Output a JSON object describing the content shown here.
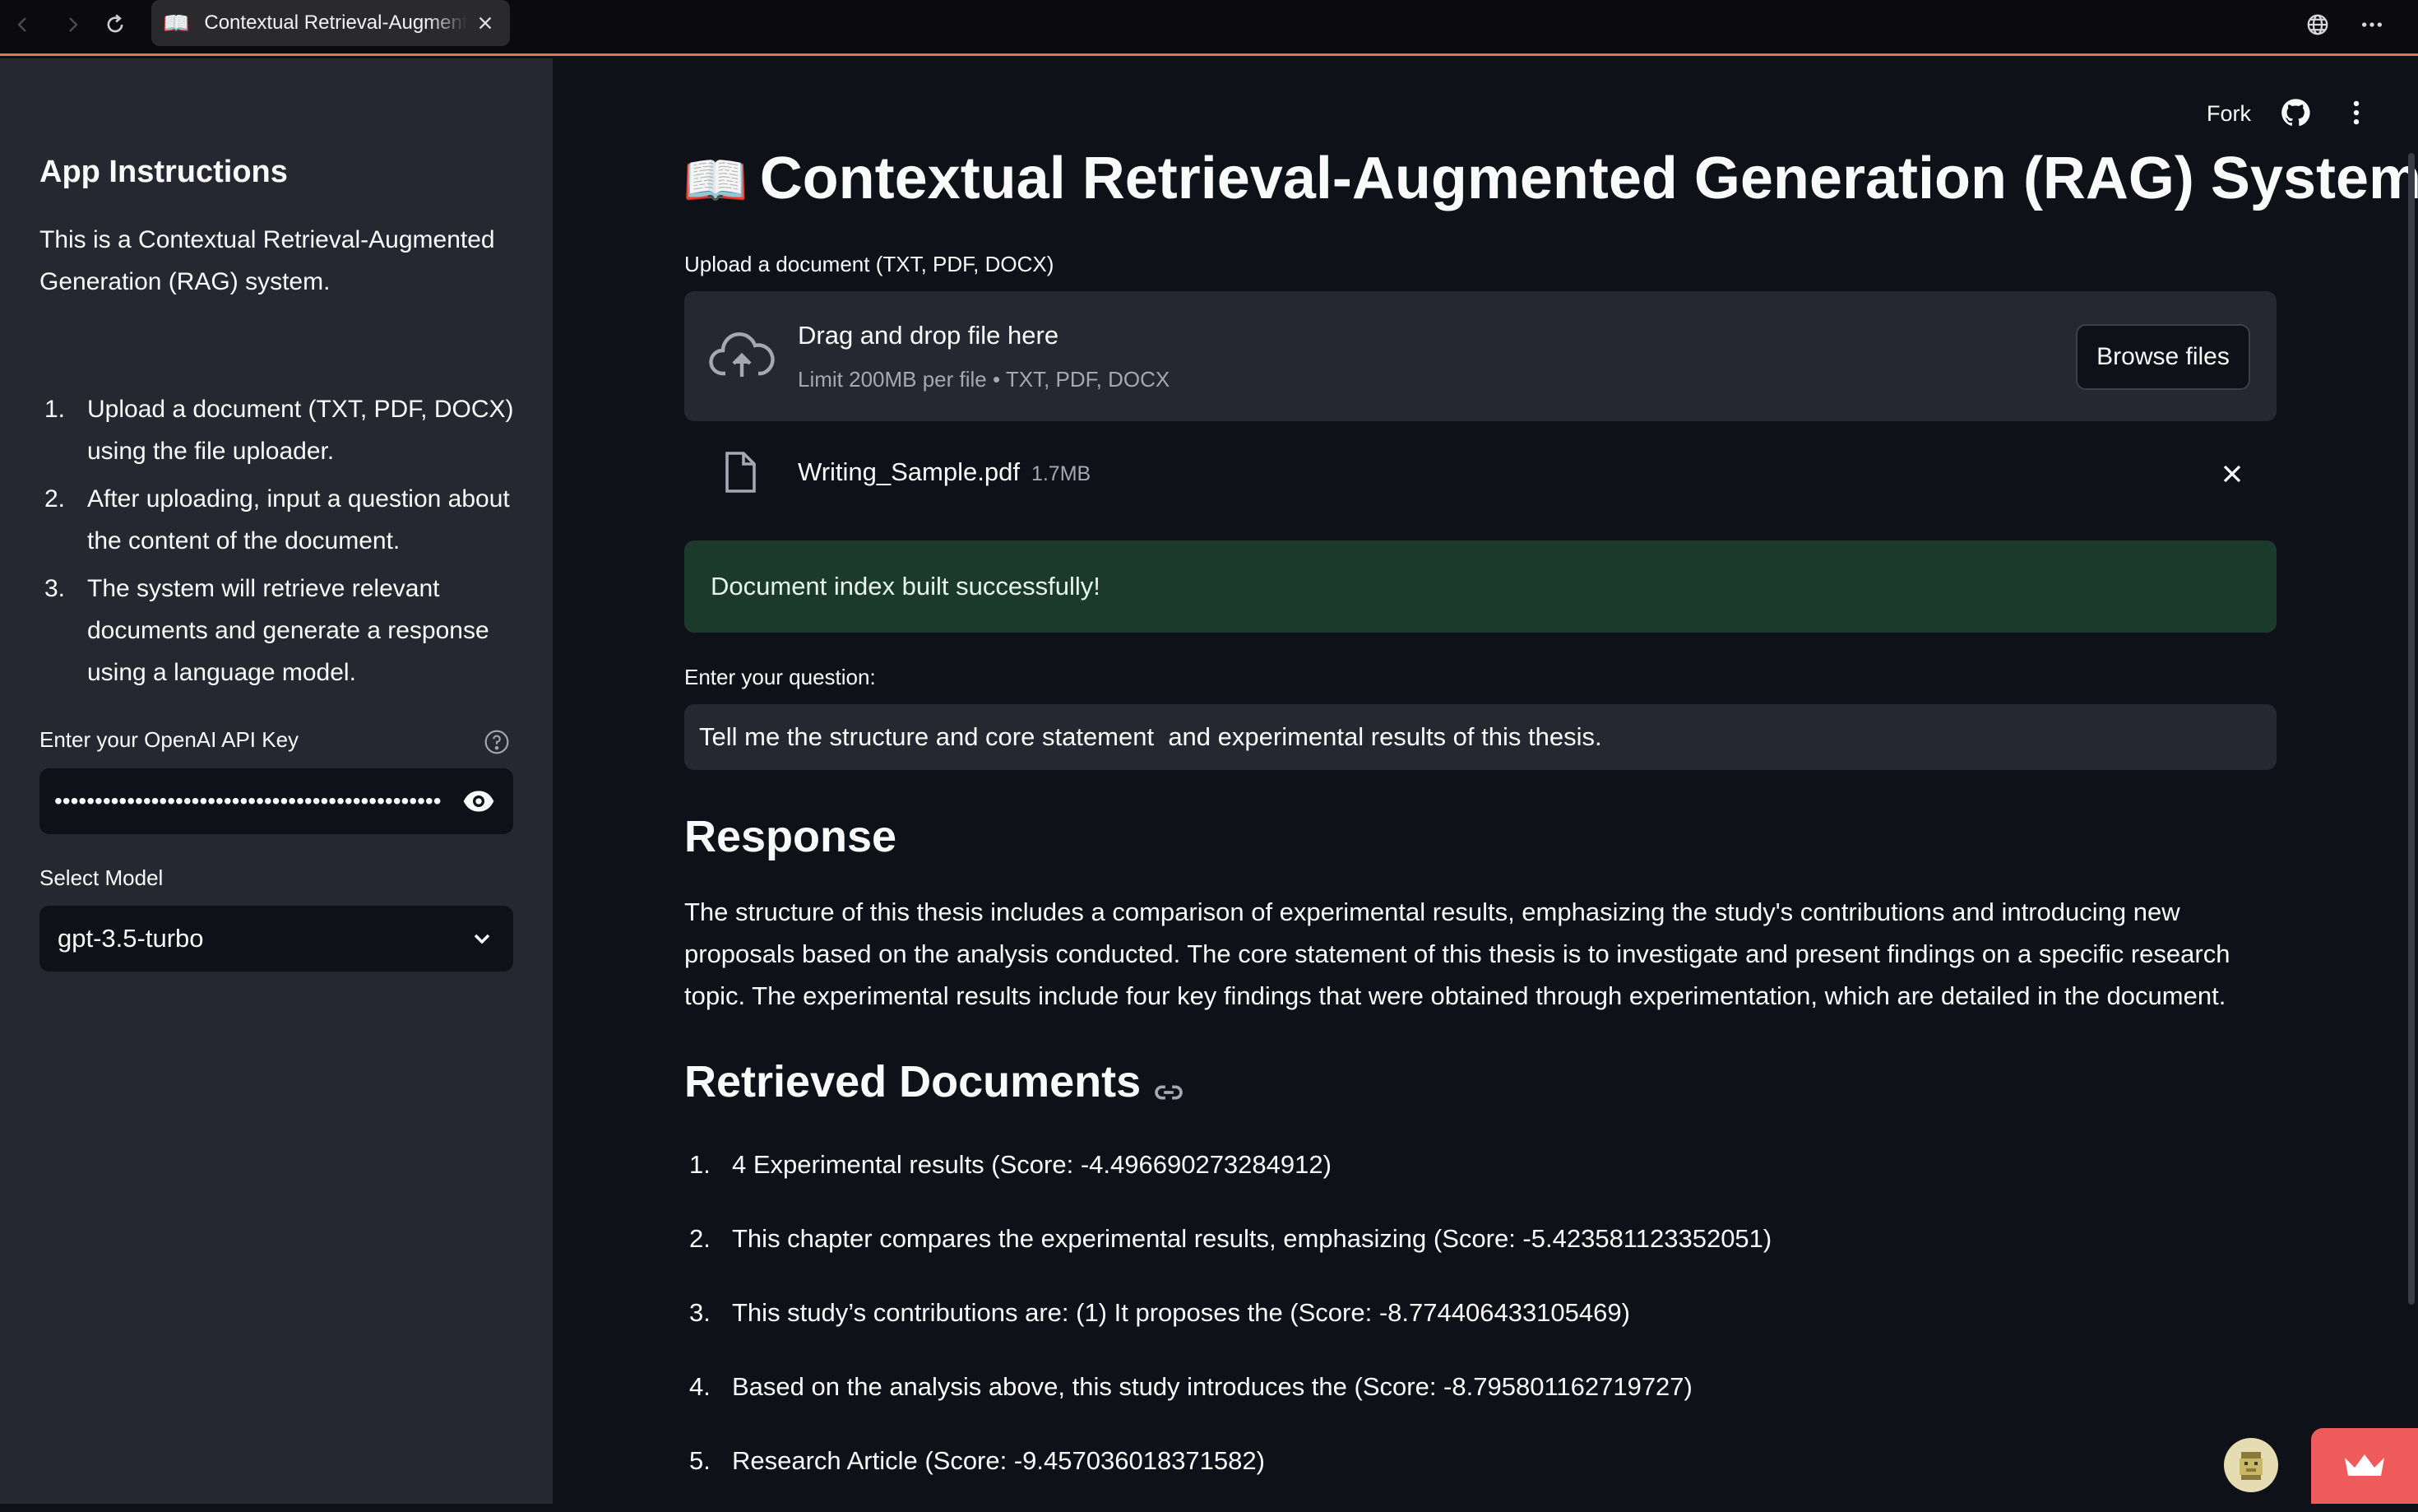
{
  "browser": {
    "tab_icon": "📖",
    "tab_title": "Contextual Retrieval-Augmented Generation (RAG) System"
  },
  "sidebar": {
    "title": "App Instructions",
    "intro": "This is a Contextual Retrieval-Augmented Generation (RAG) system.",
    "steps": [
      {
        "num": "1.",
        "text": "Upload a document (TXT, PDF, DOCX) using the file uploader."
      },
      {
        "num": "2.",
        "text": "After uploading, input a question about the content of the document."
      },
      {
        "num": "3.",
        "text": "The system will retrieve relevant documents and generate a response using a language model."
      }
    ],
    "api_key_label": "Enter your OpenAI API Key",
    "api_key_value": "••••••••••••••••••••••••••••••••••••••••••••••••••",
    "model_label": "Select Model",
    "model_value": "gpt-3.5-turbo"
  },
  "header": {
    "fork_label": "Fork"
  },
  "main": {
    "title_icon": "📖",
    "title": "Contextual Retrieval-Augmented Generation (RAG) System",
    "upload_label": "Upload a document (TXT, PDF, DOCX)",
    "dropzone_title": "Drag and drop file here",
    "dropzone_sub": "Limit 200MB per file • TXT, PDF, DOCX",
    "browse_label": "Browse files",
    "file_name": "Writing_Sample.pdf",
    "file_size": "1.7MB",
    "success_message": "Document index built successfully!",
    "question_label": "Enter your question:",
    "question_value": "Tell me the structure and core statement  and experimental results of this thesis.",
    "response_heading": "Response",
    "response_text": "The structure of this thesis includes a comparison of experimental results, emphasizing the study's contributions and introducing new proposals based on the analysis conducted. The core statement of this thesis is to investigate and present findings on a specific research topic. The experimental results include four key findings that were obtained through experimentation, which are detailed in the document.",
    "retrieved_heading": "Retrieved Documents",
    "retrieved_docs": [
      {
        "num": "1.",
        "text": "4 Experimental results (Score: -4.496690273284912)"
      },
      {
        "num": "2.",
        "text": "This chapter compares the experimental results, emphasizing (Score: -5.423581123352051)"
      },
      {
        "num": "3.",
        "text": "This study’s contributions are: (1) It proposes the (Score: -8.774406433105469)"
      },
      {
        "num": "4.",
        "text": "Based on the analysis above, this study introduces the (Score: -8.795801162719727)"
      },
      {
        "num": "5.",
        "text": "Research Article (Score: -9.457036018371582)"
      }
    ]
  },
  "icons": {
    "back": "arrow-left-icon",
    "forward": "arrow-right-icon",
    "reload": "reload-icon",
    "close_tab": "close-icon",
    "globe": "globe-icon",
    "more": "ellipsis-icon",
    "help": "question-circle-icon",
    "eye": "eye-icon",
    "chevron": "chevron-down-icon",
    "github": "github-icon",
    "kebab": "vertical-dots-icon",
    "cloud": "cloud-upload-icon",
    "file": "file-icon",
    "remove": "close-icon",
    "link": "link-icon",
    "crown": "crown-icon"
  },
  "colors": {
    "background": "#0e1117",
    "sidebar": "#262730",
    "success_bg": "#1b3a2b",
    "accent": "#ef5a5a"
  }
}
